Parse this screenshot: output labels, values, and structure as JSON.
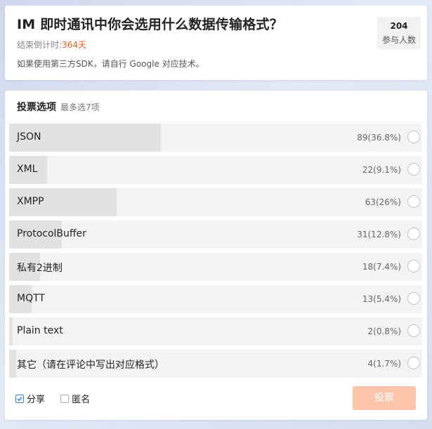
{
  "header": {
    "title": "IM 即时通讯中你会选用什么数据传输格式？",
    "countdown_label": "结束倒计时:",
    "countdown_value": "364天",
    "note": "如果使用第三方SDK，请自行 Google 对应技术。",
    "participants_count": "204",
    "participants_label": "参与人数"
  },
  "vote": {
    "heading": "投票选项",
    "limit": "最多选7项",
    "options": [
      {
        "label": "JSON",
        "stat": "89(36.8%)",
        "percent": 36.8
      },
      {
        "label": "XML",
        "stat": "22(9.1%)",
        "percent": 9.1
      },
      {
        "label": "XMPP",
        "stat": "63(26%)",
        "percent": 26
      },
      {
        "label": "ProtocolBuffer",
        "stat": "31(12.8%)",
        "percent": 12.8
      },
      {
        "label": "私有2进制",
        "stat": "18(7.4%)",
        "percent": 7.4
      },
      {
        "label": "MQTT",
        "stat": "13(5.4%)",
        "percent": 5.4
      },
      {
        "label": "Plain text",
        "stat": "2(0.8%)",
        "percent": 0.8
      },
      {
        "label": "其它（请在评论中写出对应格式）",
        "stat": "4(1.7%)",
        "percent": 1.7
      }
    ],
    "share_label": "分享",
    "anonymous_label": "匿名",
    "submit_label": "投票"
  },
  "colors": {
    "accent": "#f25b1a",
    "button": "#fcc4a9",
    "checkbox": "#3b82f6"
  }
}
